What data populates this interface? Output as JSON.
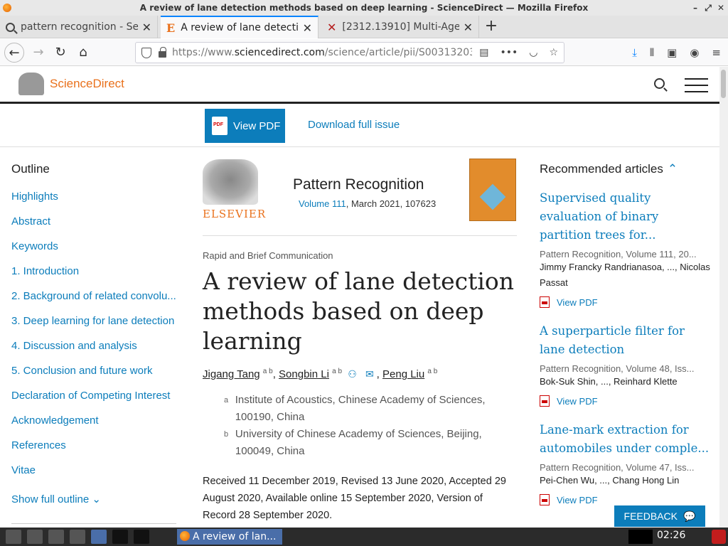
{
  "window": {
    "title": "A review of lane detection methods based on deep learning - ScienceDirect — Mozilla Firefox",
    "controls": [
      "minimize-icon",
      "restore-icon",
      "close-icon"
    ]
  },
  "tabs": [
    {
      "label": "pattern recognition - Sea",
      "icon": "search-icon",
      "active": false
    },
    {
      "label": "A review of lane detectic",
      "icon": "elsevier-e-icon",
      "active": true
    },
    {
      "label": "[2312.13910] Multi-Ager",
      "icon": "arxiv-x-icon",
      "active": false
    }
  ],
  "nav": {
    "url_prefix": "https://www.",
    "url_domain": "sciencedirect.com",
    "url_path": "/science/article/pii/S00313203"
  },
  "site": {
    "brand": "ScienceDirect",
    "view_pdf": "View PDF",
    "download_issue": "Download full issue"
  },
  "outline": {
    "heading": "Outline",
    "items": [
      "Highlights",
      "Abstract",
      "Keywords",
      "1. Introduction",
      "2. Background of related convolu...",
      "3. Deep learning for lane detection",
      "4. Discussion and analysis",
      "5. Conclusion and future work",
      "Declaration of Competing Interest",
      "Acknowledgement",
      "References",
      "Vitae"
    ],
    "show_full": "Show full outline"
  },
  "article": {
    "publisher": "ELSEVIER",
    "journal": "Pattern Recognition",
    "volume_link": "Volume 111",
    "volume_rest": ", March 2021, 107623",
    "type": "Rapid and Brief Communication",
    "title": "A review of lane detection methods based on deep learning",
    "authors": [
      {
        "name": "Jigang Tang",
        "sup": "a b"
      },
      {
        "name": "Songbin Li",
        "sup": "a b"
      },
      {
        "name": "Peng Liu",
        "sup": "a b"
      }
    ],
    "affiliations": [
      {
        "letter": "a",
        "text": "Institute of Acoustics, Chinese Academy of Sciences, 100190, China"
      },
      {
        "letter": "b",
        "text": "University of Chinese Academy of Sciences, Beijing, 100049, China"
      }
    ],
    "dates": "Received 11 December 2019, Revised 13 June 2020, Accepted 29 August 2020, Available online 15 September 2020, Version of Record 28 September 2020."
  },
  "recommended": {
    "heading": "Recommended articles",
    "items": [
      {
        "title": "Supervised quality evaluation of binary partition trees for...",
        "source": "Pattern Recognition, Volume 111, 20...",
        "authors": "Jimmy Francky Randrianasoa, ..., Nicolas Passat",
        "pdf": "View PDF"
      },
      {
        "title": "A superparticle filter for lane detection",
        "source": "Pattern Recognition, Volume 48, Iss...",
        "authors": "Bok-Suk Shin, ..., Reinhard Klette",
        "pdf": "View PDF"
      },
      {
        "title": "Lane-mark extraction for automobiles under comple...",
        "source": "Pattern Recognition, Volume 47, Iss...",
        "authors": "Pei-Chen Wu, ..., Chang Hong Lin",
        "pdf": "View PDF"
      }
    ]
  },
  "feedback": "FEEDBACK",
  "taskbar": {
    "task_label": "A review of lan...",
    "time": "02:26"
  }
}
